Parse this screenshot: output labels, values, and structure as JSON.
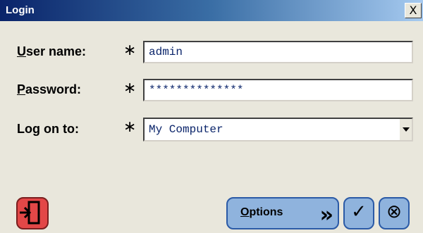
{
  "window": {
    "title": "Login",
    "close_symbol": "X"
  },
  "form": {
    "username": {
      "label_first": "U",
      "label_rest": "ser name:",
      "value": "admin",
      "required_mark": "∗"
    },
    "password": {
      "label_first": "P",
      "label_rest": "assword:",
      "value": "**************",
      "required_mark": "∗"
    },
    "logon": {
      "label": "Log on to:",
      "value": "My Computer",
      "required_mark": "∗"
    }
  },
  "buttons": {
    "exit_icon": "exit-door-icon",
    "options_first": "O",
    "options_rest": "ptions",
    "options_chevrons": "»",
    "ok_symbol": "✓",
    "cancel_symbol": "⊗"
  },
  "colors": {
    "title_start": "#0a246a",
    "title_end": "#a6caf0",
    "button_fill": "#8fb3dd",
    "exit_fill": "#e34747",
    "dialog_bg": "#e9e7dc"
  }
}
